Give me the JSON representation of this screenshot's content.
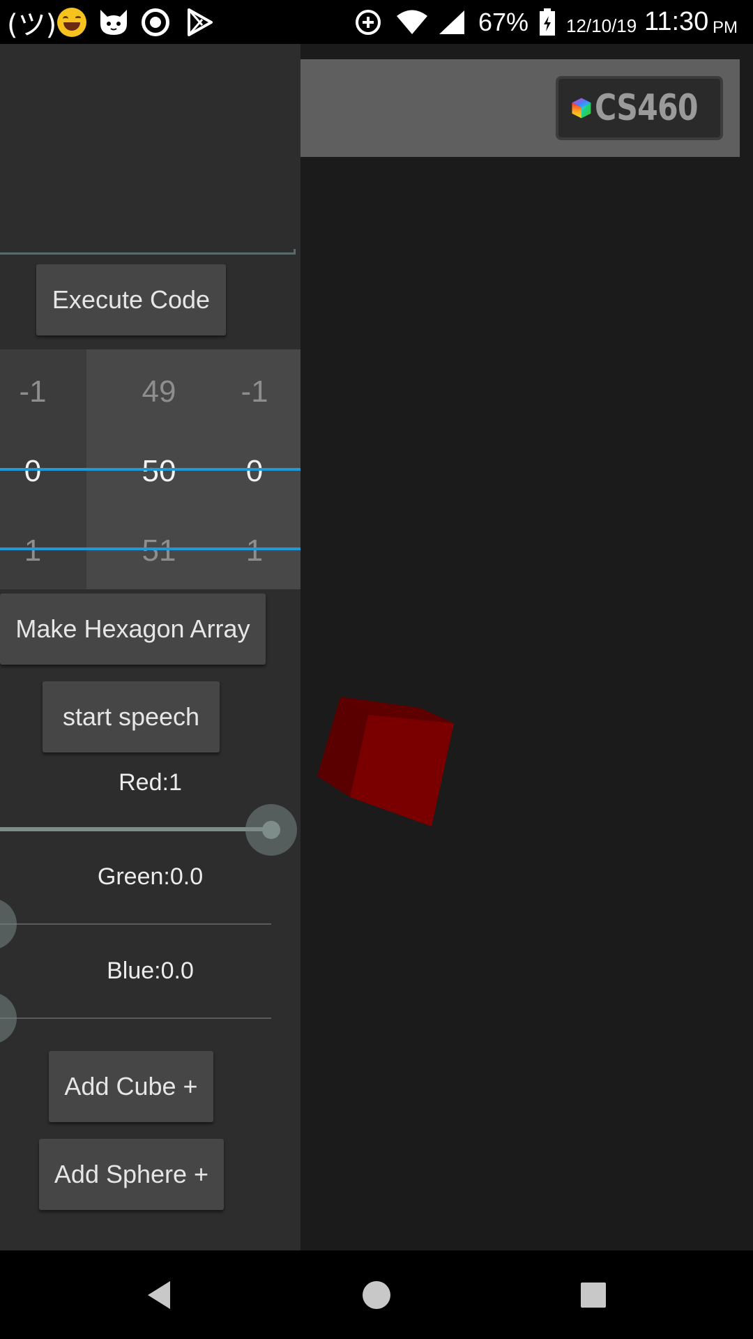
{
  "status_bar": {
    "kaomoji": "(ツ)",
    "notification_icons": [
      "grinning-emoji-icon",
      "cat-icon",
      "record-icon",
      "play-store-icon"
    ],
    "system_icons": [
      "data-saver-icon",
      "wifi-icon",
      "cell-signal-icon",
      "battery-charging-icon"
    ],
    "battery_percent": "67%",
    "date": "12/10/19",
    "time": "11:30",
    "ampm": "PM"
  },
  "header": {
    "logo_text": "CS460",
    "logo_icon": "rgb-cube-icon"
  },
  "drawer": {
    "execute_button": "Execute Code",
    "pickers": {
      "left": {
        "prev": "-1",
        "current": "0",
        "next": "1"
      },
      "middle": {
        "prev": "49",
        "current": "50",
        "next": "51"
      },
      "right": {
        "prev": "-1",
        "current": "0",
        "next": "1"
      }
    },
    "hexagon_button": "Make Hexagon Array",
    "speech_button": "start speech",
    "sliders": {
      "red": {
        "label": "Red:1",
        "value": 1.0
      },
      "green": {
        "label": "Green:0.0",
        "value": 0.0
      },
      "blue": {
        "label": "Blue:0.0",
        "value": 0.0
      }
    },
    "add_cube_button": "Add Cube +",
    "add_sphere_button": "Add Sphere +"
  },
  "scene": {
    "object": "red-cube",
    "cube_color": "#7a0000"
  },
  "nav_bar": {
    "buttons": [
      "back-icon",
      "home-icon",
      "recents-icon"
    ]
  },
  "colors": {
    "accent_divider": "#1e9bd6",
    "drawer_bg": "#2d2d2d",
    "scene_bg": "#1b1b1b"
  }
}
